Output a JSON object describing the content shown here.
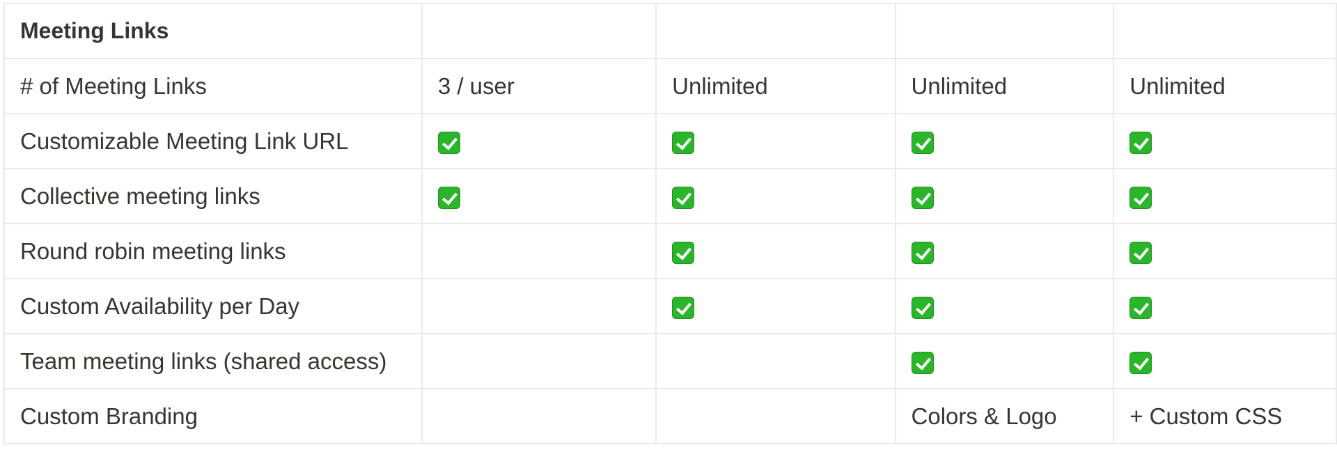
{
  "section_title": "Meeting Links",
  "rows": [
    {
      "feature": "# of Meeting Links",
      "cells": [
        "3 / user",
        "Unlimited",
        "Unlimited",
        "Unlimited"
      ]
    },
    {
      "feature": "Customizable Meeting Link URL",
      "cells": [
        true,
        true,
        true,
        true
      ]
    },
    {
      "feature": "Collective meeting links",
      "cells": [
        true,
        true,
        true,
        true
      ]
    },
    {
      "feature": "Round robin meeting links",
      "cells": [
        false,
        true,
        true,
        true
      ]
    },
    {
      "feature": "Custom Availability per Day",
      "cells": [
        false,
        true,
        true,
        true
      ]
    },
    {
      "feature": "Team meeting links (shared access)",
      "cells": [
        false,
        false,
        true,
        true
      ]
    },
    {
      "feature": "Custom Branding",
      "cells": [
        "",
        "",
        "Colors & Logo",
        "+ Custom CSS"
      ]
    }
  ],
  "icons": {
    "included": "check-mark-icon"
  },
  "colors": {
    "check_bg": "#2bb52b",
    "border": "#e9e9e7",
    "text": "#37352f"
  }
}
